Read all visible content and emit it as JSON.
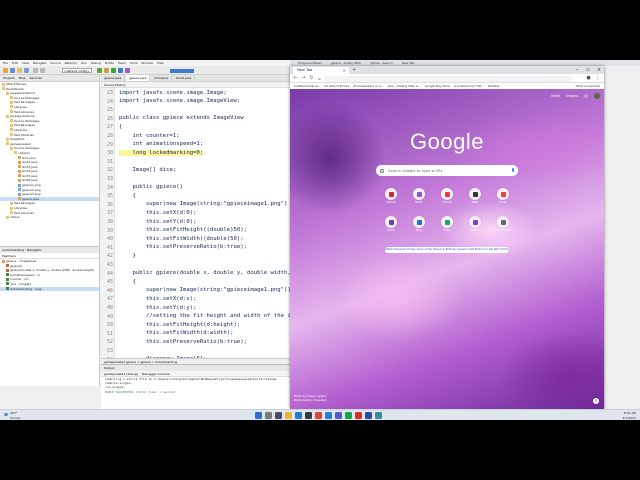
{
  "ide": {
    "menu": [
      "File",
      "Edit",
      "View",
      "Navigate",
      "Source",
      "Refactor",
      "Run",
      "Debug",
      "Profile",
      "Team",
      "Tools",
      "Window",
      "Help"
    ],
    "config_combo": "<default config>",
    "project_tabs": [
      "Projects",
      "Files",
      "Services"
    ],
    "tree": [
      "AttackHeroes",
      "QuestGame",
      "javaapplication4",
      "Source Packages",
      "Test Packages",
      "Libraries",
      "Test Libraries",
      "javaapplication1",
      "Source Packages",
      "Test Packages",
      "Libraries",
      "Test Libraries",
      "SnapShot",
      "gamepoweled",
      "Source Packages",
      "collision",
      "Grid.java",
      "Grid2.java",
      "Grid3.java",
      "Grid4.java",
      "Grid5.java",
      "Grid6.java",
      "gpiece1.png",
      "gpiece2.png",
      "gpiece3.png",
      "gpiece.java",
      "Test Packages",
      "Libraries",
      "Test Libraries",
      "others"
    ],
    "navigator_title": "lockedmarking - Navigator",
    "members_label": "Members",
    "members": [
      "gpiece :: ImageView",
      "gpiece()",
      "gpiece(double x, double y, double width, double height)",
      "animationspeed : in",
      "counter : int",
      "dice : Image[]",
      "lockedmarking : long"
    ],
    "editor_tabs": [
      "gpiece.java",
      "gpiece.java",
      "Grid.java",
      "Grid2.java"
    ],
    "editor_toolbar": "Source  History",
    "code": {
      "lines": [
        {
          "n": "23",
          "text": "import javafx.scene.image.Image;"
        },
        {
          "n": "24",
          "text": "import javafx.scene.image.ImageView;"
        },
        {
          "n": "25",
          "text": ""
        },
        {
          "n": "26",
          "text": "public class gpiece extends ImageView"
        },
        {
          "n": "27",
          "text": "{"
        },
        {
          "n": "28",
          "text": "    int counter=1;"
        },
        {
          "n": "29",
          "text": "    int animationspeed=1;"
        },
        {
          "n": "30",
          "text": "    long lockedmarking=0;"
        },
        {
          "n": "31",
          "text": ""
        },
        {
          "n": "32",
          "text": "    Image[] dice;"
        },
        {
          "n": "33",
          "text": ""
        },
        {
          "n": "34",
          "text": "    public gpiece()"
        },
        {
          "n": "35",
          "text": "    {"
        },
        {
          "n": "36",
          "text": "        super(new Image(string:\"gpieceimage1.png\")"
        },
        {
          "n": "37",
          "text": "        this.setX(d:0);"
        },
        {
          "n": "38",
          "text": "        this.setY(d:0);"
        },
        {
          "n": "39",
          "text": "        this.setFitHeight((double)50);"
        },
        {
          "n": "40",
          "text": "        this.setFitWidth((double)50);"
        },
        {
          "n": "41",
          "text": "        this.setPreserveRatio(b:true);"
        },
        {
          "n": "42",
          "text": "    }"
        },
        {
          "n": "43",
          "text": ""
        },
        {
          "n": "44",
          "text": "    public gpiece(double x, double y, double width,"
        },
        {
          "n": "45",
          "text": "    {"
        },
        {
          "n": "46",
          "text": "        super(new Image(string:\"gpieceimage1.png\"));"
        },
        {
          "n": "47",
          "text": "        this.setX(d:x);"
        },
        {
          "n": "48",
          "text": "        this.setY(d:y);"
        },
        {
          "n": "49",
          "text": "        //setting the fit height and width of the im"
        },
        {
          "n": "50",
          "text": "        this.setFitHeight(d:height);"
        },
        {
          "n": "51",
          "text": "        this.setFitWidth(d:width);"
        },
        {
          "n": "52",
          "text": "        this.setPreserveRatio(b:true);"
        },
        {
          "n": "53",
          "text": ""
        },
        {
          "n": "54",
          "text": "        dice=new Image[6];"
        }
      ]
    },
    "editor_status": "gamepoweled.gpiece  >  gpiece  >  lockedmarking",
    "output": {
      "tabs": "Output",
      "subtabs": [
        "gamepoweled (debug)",
        "Debugger Console"
      ],
      "lines": [
        "Compiling 1 source file to C:\\Users\\coding\\Documents\\NetBeansProjects\\gamepoweled\\build\\classes",
        "compile-single:",
        "run-single:",
        "BUILD SUCCESSFUL (total time: 1 second)"
      ]
    }
  },
  "top_tabs": [
    "Hollywood-Bowl",
    "gpiece - IntelliJ IDEA",
    "github - Search",
    "New Tab"
  ],
  "browser": {
    "tab_title": "New Tab",
    "omnibox_placeholder": "",
    "bookmarks": [
      "Craftsmanship bl...",
      "ZX Rollout Picture",
      "ZoomAwkward on A...",
      "Java - Hosting Sites in...",
      "Google Play Store",
      "Live Stream by TVE...",
      "Pokedex",
      "Other bookmarks"
    ],
    "ntp_links": [
      "Gmail",
      "Images"
    ],
    "logo": "Google",
    "search_placeholder": "Search Google or type a URL",
    "shortcuts": [
      {
        "label": "Youtube",
        "color": "#c4302b"
      },
      {
        "label": "Twitch",
        "color": "#8a5cc8"
      },
      {
        "label": "Chrome",
        "color": "#db4437"
      },
      {
        "label": "IMDb",
        "color": "#333333"
      },
      {
        "label": "Gmail",
        "color": "#ea4335"
      },
      {
        "label": "Twitch",
        "color": "#6441a5"
      },
      {
        "label": "Bing",
        "color": "#2a6fd6"
      },
      {
        "label": "Drive",
        "color": "#1fa463"
      },
      {
        "label": "GitHub",
        "color": "#8a3ad0"
      },
      {
        "label": "Add shortcut",
        "color": "#666666"
      }
    ],
    "promo": "Watch Pussykins Frozen Glory of the Heavenly Birthday Spears! Visit Photos for the NYC Art Project!",
    "attribution": [
      "Photo by Casey Oyster",
      "Photo Gallery Unsplash"
    ]
  },
  "taskbar": {
    "weather_temp": "49°F",
    "weather_desc": "Cloudy",
    "time": "8:01 AM",
    "date": "4/7/2023"
  }
}
